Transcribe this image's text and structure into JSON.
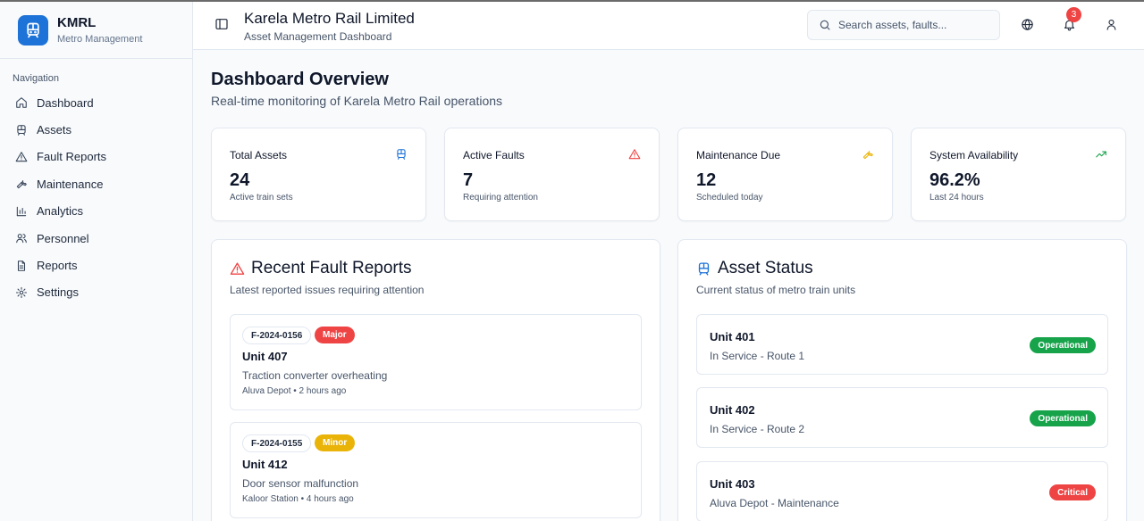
{
  "app": {
    "name": "KMRL",
    "subtitle": "Metro Management"
  },
  "colors": {
    "brand": "#1e73d8",
    "major": "#ef4444",
    "minor": "#eab308",
    "operational": "#16a34a",
    "critical": "#ef4444",
    "trend": "#16a34a",
    "maintenance_icon": "#eab308"
  },
  "sidebar": {
    "section_title": "Navigation",
    "items": [
      {
        "label": "Dashboard",
        "icon": "home-icon"
      },
      {
        "label": "Assets",
        "icon": "train-icon"
      },
      {
        "label": "Fault Reports",
        "icon": "alert-triangle-icon"
      },
      {
        "label": "Maintenance",
        "icon": "wrench-icon"
      },
      {
        "label": "Analytics",
        "icon": "bar-chart-icon"
      },
      {
        "label": "Personnel",
        "icon": "users-icon"
      },
      {
        "label": "Reports",
        "icon": "file-text-icon"
      },
      {
        "label": "Settings",
        "icon": "settings-icon"
      }
    ]
  },
  "header": {
    "title": "Karela Metro Rail Limited",
    "subtitle": "Asset Management Dashboard",
    "search_placeholder": "Search assets, faults...",
    "notification_count": "3"
  },
  "main": {
    "title": "Dashboard Overview",
    "subtitle": "Real-time monitoring of Karela Metro Rail operations"
  },
  "stats": [
    {
      "label": "Total Assets",
      "value": "24",
      "note": "Active train sets",
      "icon": "train-icon"
    },
    {
      "label": "Active Faults",
      "value": "7",
      "note": "Requiring attention",
      "icon": "alert-triangle-icon"
    },
    {
      "label": "Maintenance Due",
      "value": "12",
      "note": "Scheduled today",
      "icon": "wrench-icon"
    },
    {
      "label": "System Availability",
      "value": "96.2%",
      "note": "Last 24 hours",
      "icon": "trending-up-icon"
    }
  ],
  "faults_panel": {
    "title": "Recent Fault Reports",
    "subtitle": "Latest reported issues requiring attention",
    "items": [
      {
        "id": "F-2024-0156",
        "severity": "Major",
        "unit": "Unit 407",
        "description": "Traction converter overheating",
        "meta": "Aluva Depot • 2 hours ago"
      },
      {
        "id": "F-2024-0155",
        "severity": "Minor",
        "unit": "Unit 412",
        "description": "Door sensor malfunction",
        "meta": "Kaloor Station • 4 hours ago"
      }
    ]
  },
  "assets_panel": {
    "title": "Asset Status",
    "subtitle": "Current status of metro train units",
    "items": [
      {
        "name": "Unit 401",
        "location": "In Service - Route 1",
        "status": "Operational"
      },
      {
        "name": "Unit 402",
        "location": "In Service - Route 2",
        "status": "Operational"
      },
      {
        "name": "Unit 403",
        "location": "Aluva Depot - Maintenance",
        "status": "Critical"
      }
    ]
  }
}
